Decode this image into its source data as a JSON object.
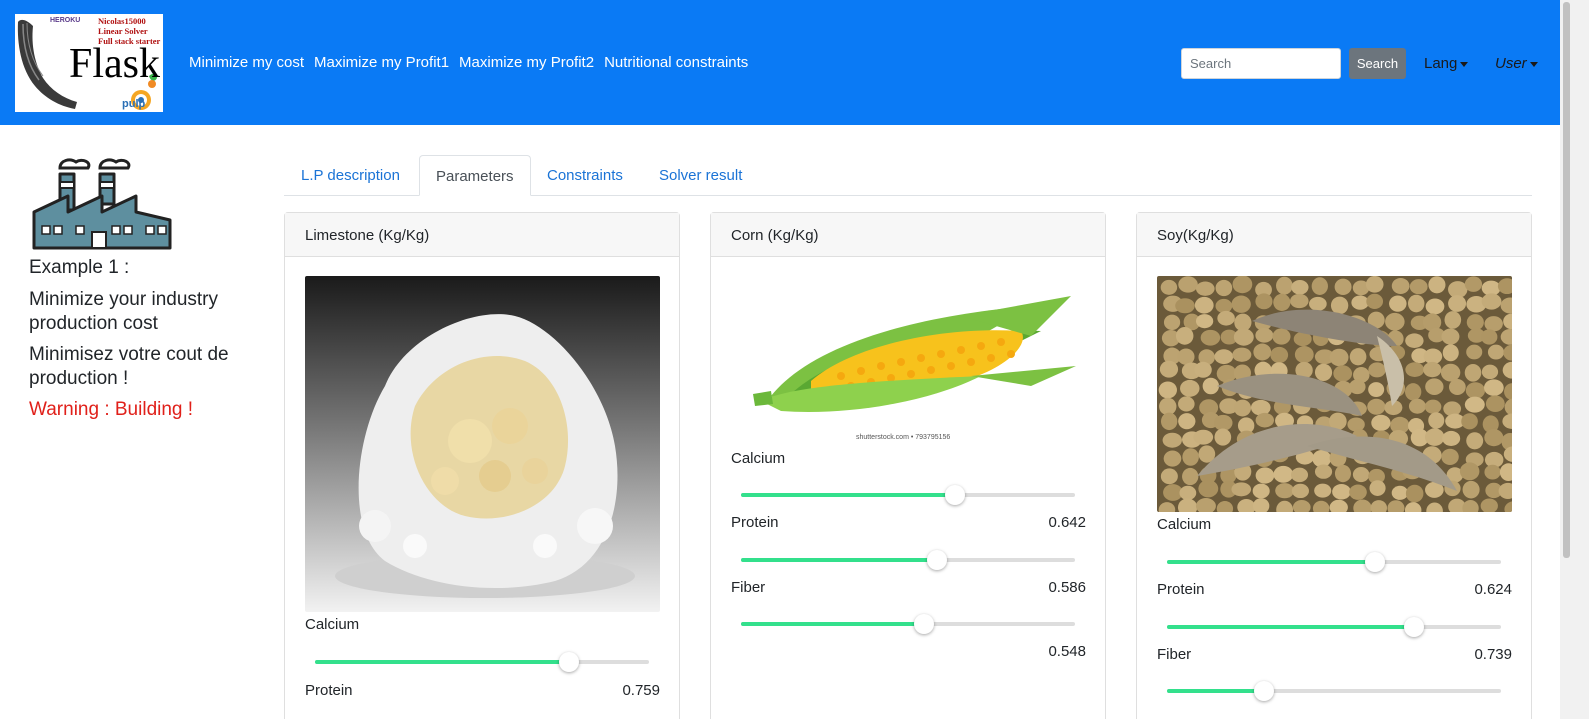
{
  "navbar": {
    "logo": {
      "heroku": "HEROKU",
      "line1": "Nicolas15000",
      "line2": "Linear Solver",
      "line3": "Full stack starter",
      "flask": "Flask",
      "pulp": "pulp"
    },
    "links": [
      {
        "label": "Minimize my cost"
      },
      {
        "label": "Maximize my Profit1"
      },
      {
        "label": "Maximize my Profit2"
      },
      {
        "label": "Nutritional constraints"
      }
    ],
    "search_placeholder": "Search",
    "search_button": "Search",
    "lang_label": "Lang",
    "user_label": "User"
  },
  "sidebar": {
    "example": "Example 1 :",
    "desc_en": "Minimize your industry production cost",
    "desc_fr": "Minimisez votre cout de production !",
    "warning": "Warning : Building !"
  },
  "tabs": [
    {
      "label": "L.P description",
      "active": false
    },
    {
      "label": "Parameters",
      "active": true
    },
    {
      "label": "Constraints",
      "active": false
    },
    {
      "label": "Solver result",
      "active": false
    }
  ],
  "colors": {
    "navbar": "#0a7af5",
    "slider_fill": "#33e08c",
    "tab_link": "#1a73d6",
    "warning": "#e0201a"
  },
  "cards": [
    {
      "title": "Limestone (Kg/Kg)",
      "image": "limestone-image",
      "features": [
        {
          "label": "Calcium",
          "value": "0.759",
          "level": 0.759
        },
        {
          "label": "Protein",
          "value": "0.759",
          "level": 0.759
        }
      ]
    },
    {
      "title": "Corn (Kg/Kg)",
      "image": "corn-image",
      "watermark": "shutterstock.com • 793795156",
      "features": [
        {
          "label": "Calcium",
          "value": "0.642",
          "level": 0.642
        },
        {
          "label": "Protein",
          "value": "0.586",
          "level": 0.586
        },
        {
          "label": "Fiber",
          "value": "0.548",
          "level": 0.548
        }
      ]
    },
    {
      "title": "Soy(Kg/Kg)",
      "image": "soy-image",
      "features": [
        {
          "label": "Calcium",
          "value": "0.624",
          "level": 0.624
        },
        {
          "label": "Protein",
          "value": "0.739",
          "level": 0.739
        },
        {
          "label": "Fiber",
          "value": "",
          "level": 0.29
        }
      ]
    }
  ]
}
